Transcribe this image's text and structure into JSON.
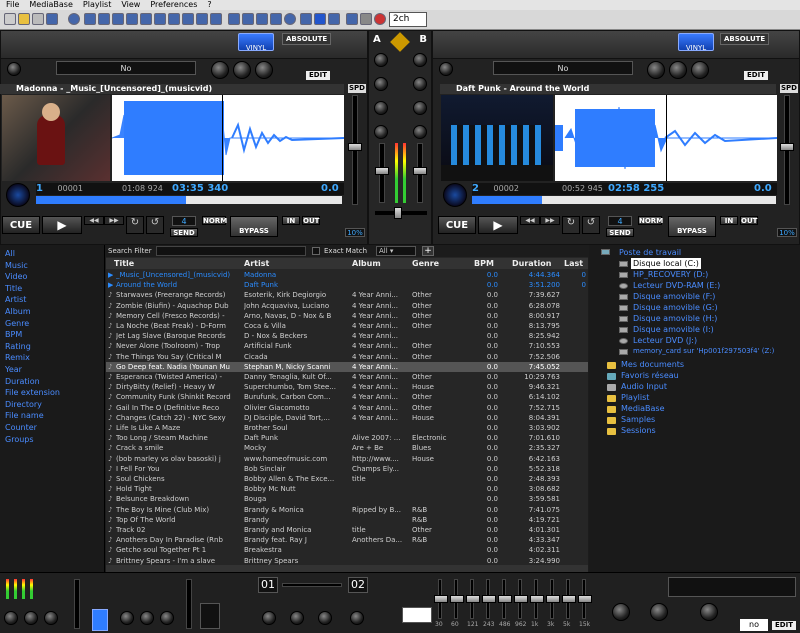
{
  "menu": {
    "file": "File",
    "mediabase": "MediaBase",
    "playlist": "Playlist",
    "view": "View",
    "preferences": "Preferences",
    "help": "?"
  },
  "toolbar": {
    "channel_select": "2ch"
  },
  "deckA": {
    "vinyl_label": "VINYL",
    "absolute_label": "ABSOLUTE",
    "effect_name": "No",
    "edit_label": "EDIT",
    "spd_label": "SPD",
    "title": "Madonna - _Music_[Uncensored]_(musicvid)",
    "deck_no": "1",
    "track_no": "00001",
    "elapsed": "01:08 924",
    "remain": "03:35 340",
    "pitch": "0.0",
    "cue_label": "CUE",
    "loop_len": "4",
    "send_label": "SEND",
    "norm_label": "NORM",
    "bypass_label": "BYPASS",
    "in_label": "IN",
    "out_label": "OUT",
    "pct": "10%"
  },
  "deckB": {
    "vinyl_label": "VINYL",
    "absolute_label": "ABSOLUTE",
    "effect_name": "No",
    "edit_label": "EDIT",
    "spd_label": "SPD",
    "title": "Daft Punk - Around the World",
    "deck_no": "2",
    "track_no": "00002",
    "elapsed": "00:52 945",
    "remain": "02:58 255",
    "pitch": "0.0",
    "cue_label": "CUE",
    "loop_len": "4",
    "send_label": "SEND",
    "norm_label": "NORM",
    "bypass_label": "BYPASS",
    "in_label": "IN",
    "out_label": "OUT",
    "pct": "10%"
  },
  "mixer": {
    "a": "A",
    "b": "B"
  },
  "categories": [
    "All",
    "Music",
    "Video",
    "Title",
    "Artist",
    "Album",
    "Genre",
    "BPM",
    "Rating",
    "Remix",
    "Year",
    "Duration",
    "File extension",
    "Directory",
    "File name",
    "Counter",
    "Groups"
  ],
  "search": {
    "label": "Search Filter",
    "exact": "Exact Match",
    "filter": "All"
  },
  "columns": [
    "Title",
    "Artist",
    "Album",
    "Genre",
    "BPM",
    "Duration",
    "Last"
  ],
  "rows": [
    {
      "title": "_Music_[Uncensored]_(musicvid)",
      "artist": "Madonna",
      "album": "",
      "genre": "",
      "bpm": "0.0",
      "dur": "4:44.364",
      "last": "0",
      "style": "blue"
    },
    {
      "title": "Around the World",
      "artist": "Daft Punk",
      "album": "",
      "genre": "",
      "bpm": "0.0",
      "dur": "3:51.200",
      "last": "0",
      "style": "blue"
    },
    {
      "title": "Starwaves (Freerange Records)",
      "artist": "Esoterik, Kirk Degiorgio",
      "album": "4 Year Anni...",
      "genre": "Other",
      "bpm": "0.0",
      "dur": "7:39.627",
      "last": "",
      "style": ""
    },
    {
      "title": "Zombie (Biufin) - Aquachop Dub",
      "artist": "John Acquaviva, Luciano",
      "album": "4 Year Anni...",
      "genre": "Other",
      "bpm": "0.0",
      "dur": "6:28.078",
      "last": "",
      "style": ""
    },
    {
      "title": "Memory Cell (Fresco Records) -",
      "artist": "Arno, Navas, D - Nox & B",
      "album": "4 Year Anni...",
      "genre": "Other",
      "bpm": "0.0",
      "dur": "8:00.917",
      "last": "",
      "style": ""
    },
    {
      "title": "La Noche (Beat Freak) - D-Form",
      "artist": "Coca & Villa",
      "album": "4 Year Anni...",
      "genre": "Other",
      "bpm": "0.0",
      "dur": "8:13.795",
      "last": "",
      "style": ""
    },
    {
      "title": "Jet Lag Slave (Baroque Records",
      "artist": "D - Nox & Beckers",
      "album": "4 Year Anni...",
      "genre": "",
      "bpm": "0.0",
      "dur": "8:25.942",
      "last": "",
      "style": ""
    },
    {
      "title": "Never Alone (Toolroom) - Trop",
      "artist": "Artificial Funk",
      "album": "4 Year Anni...",
      "genre": "Other",
      "bpm": "0.0",
      "dur": "7:10.553",
      "last": "",
      "style": ""
    },
    {
      "title": "The Things You Say (Critical M",
      "artist": "Cicada",
      "album": "4 Year Anni...",
      "genre": "Other",
      "bpm": "0.0",
      "dur": "7:52.506",
      "last": "",
      "style": ""
    },
    {
      "title": "Go Deep feat. Nadia (Younan Mu",
      "artist": "Stephan M, Nicky Scanni",
      "album": "4 Year Anni...",
      "genre": "",
      "bpm": "0.0",
      "dur": "7:45.052",
      "last": "",
      "style": "sel"
    },
    {
      "title": "Esperanca (Twisted America) -",
      "artist": "Danny Tenaglia, Kult Of...",
      "album": "4 Year Anni...",
      "genre": "Other",
      "bpm": "0.0",
      "dur": "10:29.763",
      "last": "",
      "style": ""
    },
    {
      "title": "DirtyBitty (Relief) - Heavy W",
      "artist": "Superchumbo, Tom Stee...",
      "album": "4 Year Anni...",
      "genre": "House",
      "bpm": "0.0",
      "dur": "9:46.321",
      "last": "",
      "style": ""
    },
    {
      "title": "Community Funk (Shinkit Record",
      "artist": "Burufunk, Carbon Com...",
      "album": "4 Year Anni...",
      "genre": "Other",
      "bpm": "0.0",
      "dur": "6:14.102",
      "last": "",
      "style": ""
    },
    {
      "title": "Gail In The O (Definitive Reco",
      "artist": "Olivier Giacomotto",
      "album": "4 Year Anni...",
      "genre": "Other",
      "bpm": "0.0",
      "dur": "7:52.715",
      "last": "",
      "style": ""
    },
    {
      "title": "Changes (Catch 22) - NYC Sexy",
      "artist": "DJ Disciple, David Tort,...",
      "album": "4 Year Anni...",
      "genre": "House",
      "bpm": "0.0",
      "dur": "8:04.391",
      "last": "",
      "style": ""
    },
    {
      "title": "Life Is Like A Maze",
      "artist": "Brother Soul",
      "album": "",
      "genre": "",
      "bpm": "0.0",
      "dur": "3:03.902",
      "last": "",
      "style": ""
    },
    {
      "title": "Too Long / Steam Machine",
      "artist": "Daft Punk",
      "album": "Alive 2007: ...",
      "genre": "Electronic",
      "bpm": "0.0",
      "dur": "7:01.610",
      "last": "",
      "style": ""
    },
    {
      "title": "Crack a smile",
      "artist": "Mocky",
      "album": "Are + Be",
      "genre": "Blues",
      "bpm": "0.0",
      "dur": "2:35.327",
      "last": "",
      "style": ""
    },
    {
      "title": "(bob marley vs olav basoski) j",
      "artist": "www.homeofmusic.com",
      "album": "http://www....",
      "genre": "House",
      "bpm": "0.0",
      "dur": "6:42.163",
      "last": "",
      "style": ""
    },
    {
      "title": "I Fell For You",
      "artist": "Bob Sinclair",
      "album": "Champs Ely...",
      "genre": "",
      "bpm": "0.0",
      "dur": "5:52.318",
      "last": "",
      "style": ""
    },
    {
      "title": "Soul Chickens",
      "artist": "Bobby Allen & The Exce...",
      "album": "title",
      "genre": "",
      "bpm": "0.0",
      "dur": "2:48.393",
      "last": "",
      "style": ""
    },
    {
      "title": "Hold Tight",
      "artist": "Bobby Mc Nutt",
      "album": "",
      "genre": "",
      "bpm": "0.0",
      "dur": "3:08.682",
      "last": "",
      "style": ""
    },
    {
      "title": "Belsunce Breakdown",
      "artist": "Bouga",
      "album": "",
      "genre": "",
      "bpm": "0.0",
      "dur": "3:59.581",
      "last": "",
      "style": ""
    },
    {
      "title": "The Boy Is Mine (Club Mix)",
      "artist": "Brandy & Monica",
      "album": "Ripped by B...",
      "genre": "R&B",
      "bpm": "0.0",
      "dur": "7:41.075",
      "last": "",
      "style": ""
    },
    {
      "title": "Top Of The World",
      "artist": "Brandy",
      "album": "",
      "genre": "R&B",
      "bpm": "0.0",
      "dur": "4:19.721",
      "last": "",
      "style": ""
    },
    {
      "title": "Track 02",
      "artist": "Brandy and Monica",
      "album": "title",
      "genre": "Other",
      "bpm": "0.0",
      "dur": "4:01.301",
      "last": "",
      "style": ""
    },
    {
      "title": "Anothers Day In Paradise (Rnb",
      "artist": "Brandy feat. Ray J",
      "album": "Anothers Da...",
      "genre": "R&B",
      "bpm": "0.0",
      "dur": "4:33.347",
      "last": "",
      "style": ""
    },
    {
      "title": "Getcho soul Together Pt 1",
      "artist": "Breakestra",
      "album": "",
      "genre": "",
      "bpm": "0.0",
      "dur": "4:02.311",
      "last": "",
      "style": ""
    },
    {
      "title": "Brittney Spears - I'm a slave",
      "artist": "Brittney Spears",
      "album": "",
      "genre": "",
      "bpm": "0.0",
      "dur": "3:24.990",
      "last": "",
      "style": ""
    }
  ],
  "tree": {
    "root": "Poste de travail",
    "disk_c": "Disque local (C:)",
    "recovery": "HP_RECOVERY (D:)",
    "dvd_e": "Lecteur DVD-RAM (E:)",
    "rem_f": "Disque amovible (F:)",
    "rem_g": "Disque amovible (G:)",
    "rem_h": "Disque amovible (H:)",
    "rem_i": "Disque amovible (I:)",
    "dvd_j": "Lecteur DVD (J:)",
    "memcard": "memory_card sur 'Hp001f297503f4' (Z:)",
    "docs": "Mes documents",
    "favs": "Favoris réseau",
    "audio": "Audio Input",
    "playlist": "Playlist",
    "mediabase": "MediaBase",
    "samples": "Samples",
    "sessions": "Sessions"
  },
  "bottom": {
    "ch1": "01",
    "ch2": "02",
    "eq_bands": [
      "30",
      "60",
      "121",
      "243",
      "486",
      "962",
      "1k",
      "3k",
      "5k",
      "15k"
    ],
    "fx_value": "no",
    "edit_label": "EDIT"
  },
  "colors": {
    "accent": "#2b8cff",
    "waveform": "#2f7dff",
    "vinyl": "#1f5fe0"
  }
}
